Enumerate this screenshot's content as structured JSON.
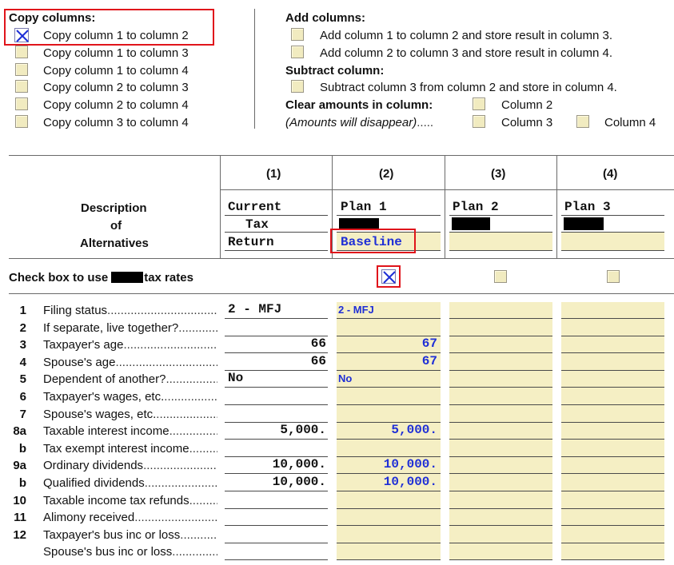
{
  "copy_columns": {
    "title": "Copy columns:",
    "items": [
      {
        "label": "Copy column 1 to column 2",
        "checked": true
      },
      {
        "label": "Copy column 1 to column 3",
        "checked": false
      },
      {
        "label": "Copy column 1 to column 4",
        "checked": false
      },
      {
        "label": "Copy column 2 to column 3",
        "checked": false
      },
      {
        "label": "Copy column 2 to column 4",
        "checked": false
      },
      {
        "label": "Copy column 3 to column 4",
        "checked": false
      }
    ]
  },
  "add_columns": {
    "title": "Add columns:",
    "items": [
      {
        "label": "Add column 1 to column 2 and store result in column 3."
      },
      {
        "label": "Add column 2 to column 3 and store result in column 4."
      }
    ]
  },
  "subtract_column": {
    "title": "Subtract column:",
    "item": "Subtract column 3 from column 2 and store in column 4."
  },
  "clear_amounts": {
    "title": "Clear amounts in column:",
    "note": "(Amounts will disappear)",
    "col2": "Column 2",
    "col3": "Column 3",
    "col4": "Column 4"
  },
  "table": {
    "headers": [
      "(1)",
      "(2)",
      "(3)",
      "(4)"
    ],
    "description_lines": [
      "Description",
      "of",
      "Alternatives"
    ],
    "col1_name": [
      "Current",
      "Tax",
      "Return"
    ],
    "col2_name": [
      "Plan 1",
      "",
      "Baseline"
    ],
    "col3_name": "Plan 2",
    "col4_name": "Plan 3",
    "check_box_label_before": "Check box to use",
    "check_box_label_after": "tax rates"
  },
  "rows": [
    {
      "num": "1",
      "label": "Filing status",
      "c1": "2 - MFJ",
      "c2": "2 - MFJ"
    },
    {
      "num": "2",
      "label": "If separate, live together?",
      "c1": "",
      "c2": ""
    },
    {
      "num": "3",
      "label": "Taxpayer's age",
      "c1": "66",
      "c2": "67"
    },
    {
      "num": "4",
      "label": "Spouse's age",
      "c1": "66",
      "c2": "67"
    },
    {
      "num": "5",
      "label": "Dependent of another?",
      "c1": "No",
      "c2": "No"
    },
    {
      "num": "6",
      "label": "Taxpayer's wages, etc.",
      "c1": "",
      "c2": ""
    },
    {
      "num": "7",
      "label": "Spouse's wages, etc.",
      "c1": "",
      "c2": ""
    },
    {
      "num": "8a",
      "label": "Taxable interest income",
      "c1": "5,000.",
      "c2": "5,000."
    },
    {
      "num": "b",
      "label": "Tax exempt interest income",
      "c1": "",
      "c2": ""
    },
    {
      "num": "9a",
      "label": "Ordinary dividends",
      "c1": "10,000.",
      "c2": "10,000."
    },
    {
      "num": "b",
      "label": "Qualified dividends",
      "c1": "10,000.",
      "c2": "10,000."
    },
    {
      "num": "10",
      "label": "Taxable income tax refunds",
      "c1": "",
      "c2": ""
    },
    {
      "num": "11",
      "label": "Alimony received",
      "c1": "",
      "c2": ""
    },
    {
      "num": "12",
      "label": "Taxpayer's bus inc or loss",
      "c1": "",
      "c2": ""
    },
    {
      "num": "",
      "label": "Spouse's bus inc or loss",
      "c1": "",
      "c2": ""
    }
  ],
  "colors": {
    "input_yellow": "#f5efc4",
    "blue_value": "#1f2fd6",
    "highlight_red": "#e0141b"
  }
}
